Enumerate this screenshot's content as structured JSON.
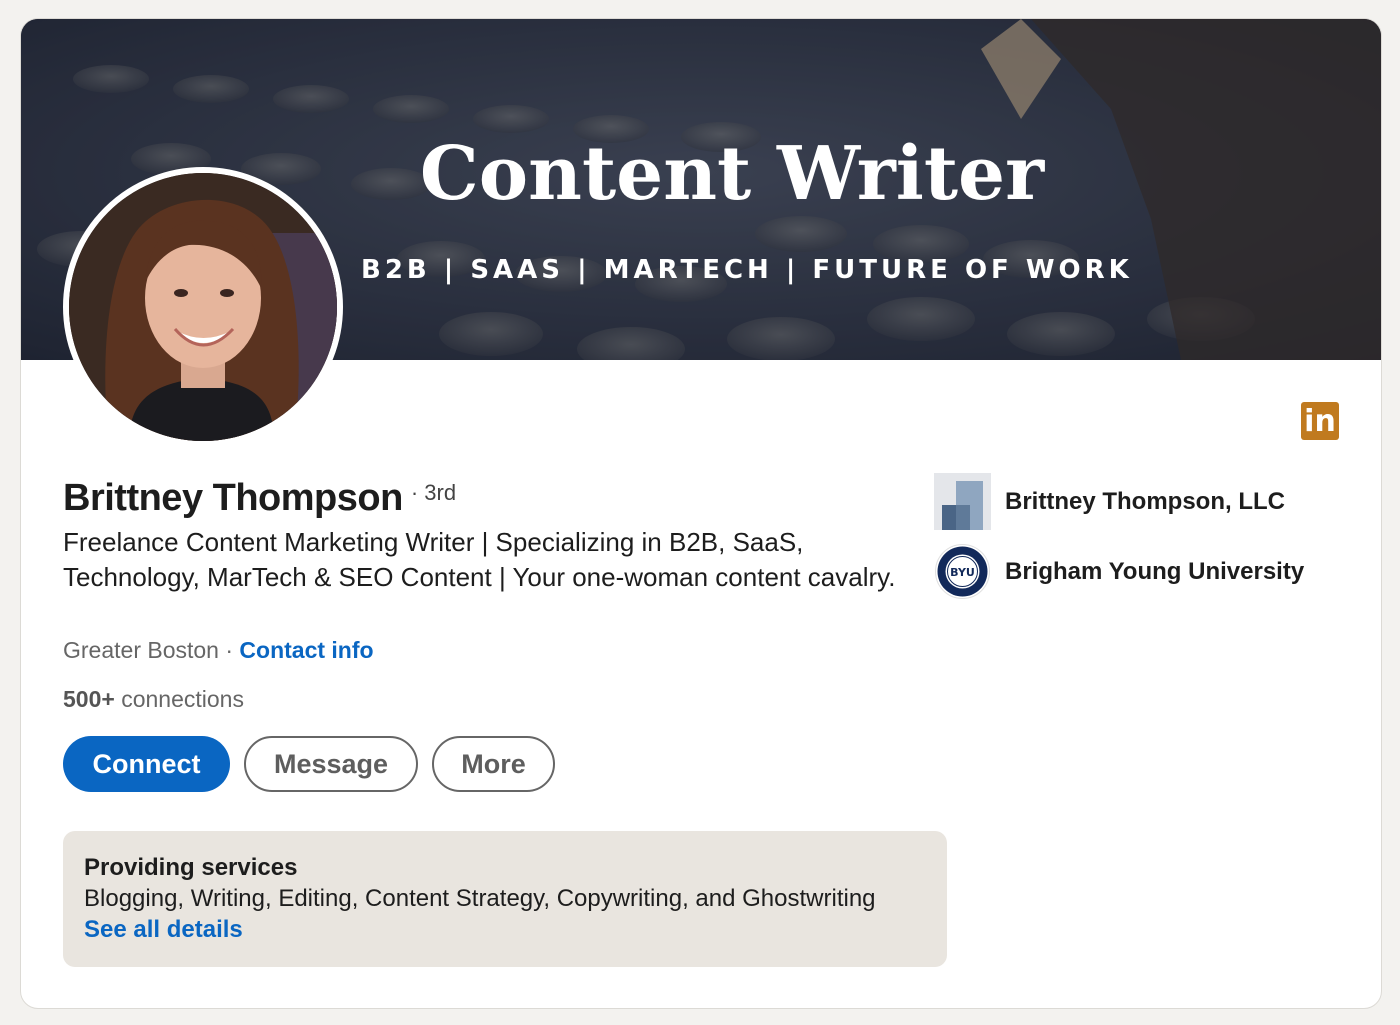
{
  "banner": {
    "title": "Content Writer",
    "subtitle": "B2B | SAAS | MARTECH | FUTURE OF WORK"
  },
  "profile": {
    "name": "Brittney Thompson",
    "degree": "· 3rd",
    "headline": "Freelance Content Marketing Writer | Specializing in B2B, SaaS, Technology, MarTech & SEO Content | Your one-woman content cavalry.",
    "location": "Greater Boston",
    "separator": " · ",
    "contact_info": "Contact info",
    "connections_count": "500+",
    "connections_label": " connections",
    "network_logo": "in"
  },
  "actions": {
    "connect": "Connect",
    "message": "Message",
    "more": "More"
  },
  "services": {
    "title": "Providing services",
    "list": "Blogging, Writing, Editing, Content Strategy, Copywriting, and Ghostwriting",
    "link": "See all details"
  },
  "sidebar": {
    "company": "Brittney Thompson, LLC",
    "school": "Brigham Young University",
    "school_logo_text": "BYU"
  },
  "colors": {
    "accent": "#0a66c2",
    "linkedin_badge": "#c07a1f",
    "services_bg": "#e9e5df",
    "page_bg": "#f3f2ef"
  }
}
